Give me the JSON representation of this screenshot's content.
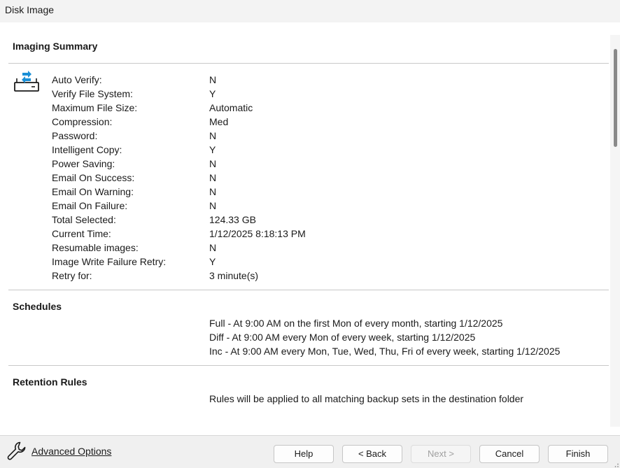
{
  "window": {
    "title": "Disk Image"
  },
  "summary": {
    "heading": "Imaging Summary",
    "icon": "drive-image-icon",
    "rows": [
      {
        "label": "Auto Verify:",
        "value": "N"
      },
      {
        "label": "Verify File System:",
        "value": "Y"
      },
      {
        "label": "Maximum File Size:",
        "value": "Automatic"
      },
      {
        "label": "Compression:",
        "value": "Med"
      },
      {
        "label": "Password:",
        "value": "N"
      },
      {
        "label": "Intelligent Copy:",
        "value": "Y"
      },
      {
        "label": "Power Saving:",
        "value": "N"
      },
      {
        "label": "Email On Success:",
        "value": "N"
      },
      {
        "label": "Email On Warning:",
        "value": "N"
      },
      {
        "label": "Email On Failure:",
        "value": "N"
      },
      {
        "label": "Total Selected:",
        "value": "124.33 GB"
      },
      {
        "label": "Current Time:",
        "value": "1/12/2025 8:18:13 PM"
      },
      {
        "label": "Resumable images:",
        "value": "N"
      },
      {
        "label": "Image Write Failure Retry:",
        "value": "Y"
      },
      {
        "label": "Retry for:",
        "value": "3 minute(s)"
      }
    ]
  },
  "schedules": {
    "heading": "Schedules",
    "items": [
      "Full - At 9:00 AM on the first Mon of every month, starting 1/12/2025",
      "Diff - At 9:00 AM every Mon of every week, starting 1/12/2025",
      "Inc - At 9:00 AM every Mon, Tue, Wed, Thu, Fri of every week, starting 1/12/2025"
    ]
  },
  "retention": {
    "heading": "Retention Rules",
    "text": "Rules will be applied to all matching backup sets in the destination folder"
  },
  "footer": {
    "advanced_options": "Advanced Options",
    "buttons": {
      "help": "Help",
      "back": "< Back",
      "next": "Next >",
      "cancel": "Cancel",
      "finish": "Finish"
    }
  },
  "colors": {
    "accent": "#1a8fd6",
    "divider": "#c8c8c8"
  }
}
